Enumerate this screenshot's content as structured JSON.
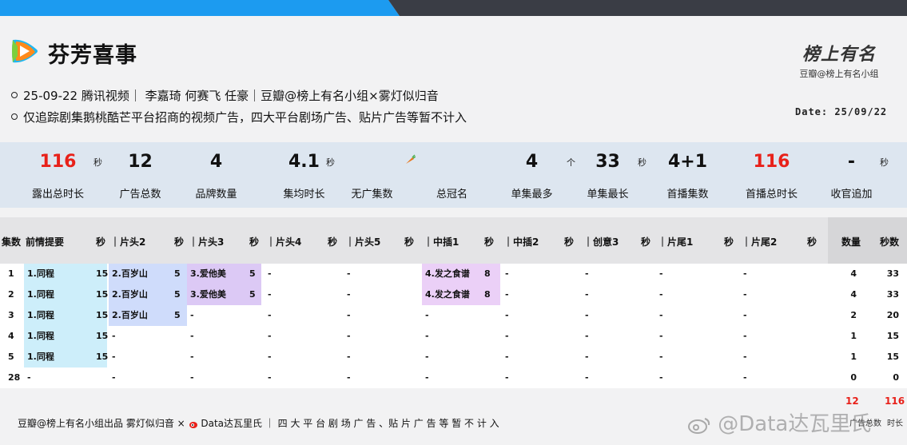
{
  "show": {
    "title": "芬芳喜事",
    "info_line_1": "25-09-22 腾讯视频｜ 李嘉琦 何赛飞 任豪｜豆瓣@榜上有名小组×雾灯似归音",
    "info_line_2": "仅追踪剧集鹅桃酷芒平台招商的视频广告，四大平台剧场广告、贴片广告等暂不计入",
    "date": "Date: 25/09/22"
  },
  "brand": {
    "script": "榜上有名",
    "sub": "豆瓣@榜上有名小组"
  },
  "stats": [
    {
      "value": "116",
      "unit": "秒",
      "label": "露出总时长",
      "red": true
    },
    {
      "value": "12",
      "unit": "",
      "label": "广告总数",
      "red": false
    },
    {
      "value": "4",
      "unit": "",
      "label": "品牌数量",
      "red": false
    },
    {
      "value": "4.1",
      "unit": "秒",
      "label": "集均时长",
      "red": false
    },
    {
      "value": "",
      "unit": "",
      "label": "无广集数",
      "red": false,
      "icon": "carrot-icon"
    },
    {
      "value": "",
      "unit": "",
      "label": "总冠名",
      "red": false
    },
    {
      "value": "4",
      "unit": "个",
      "label": "单集最多",
      "red": false
    },
    {
      "value": "33",
      "unit": "秒",
      "label": "单集最长",
      "red": false
    },
    {
      "value": "4+1",
      "unit": "",
      "label": "首播集数",
      "red": false
    },
    {
      "value": "116",
      "unit": "",
      "label": "首播总时长",
      "red": true
    },
    {
      "value": "-",
      "unit": "秒",
      "label": "收官追加",
      "red": false
    }
  ],
  "table": {
    "headers": {
      "episode": "集数",
      "cols": [
        "前情提要",
        "｜片头2",
        "｜片头3",
        "｜片头4",
        "｜片头5",
        "｜中插1",
        "｜中插2",
        "｜创意3",
        "｜片尾1",
        "｜片尾2"
      ],
      "sec": "秒",
      "count": "数量",
      "seconds": "秒数"
    },
    "rows": [
      {
        "ep": "1",
        "cells": [
          [
            "1.同程",
            "15"
          ],
          [
            "2.百岁山",
            "5"
          ],
          [
            "3.爱他美",
            "5"
          ],
          [
            "-",
            ""
          ],
          [
            "-",
            ""
          ],
          [
            "4.发之食谱",
            "8"
          ],
          [
            "-",
            ""
          ],
          [
            "-",
            ""
          ],
          [
            "-",
            ""
          ],
          [
            "-",
            ""
          ]
        ],
        "count": "4",
        "secs": "33"
      },
      {
        "ep": "2",
        "cells": [
          [
            "1.同程",
            "15"
          ],
          [
            "2.百岁山",
            "5"
          ],
          [
            "3.爱他美",
            "5"
          ],
          [
            "-",
            ""
          ],
          [
            "-",
            ""
          ],
          [
            "4.发之食谱",
            "8"
          ],
          [
            "-",
            ""
          ],
          [
            "-",
            ""
          ],
          [
            "-",
            ""
          ],
          [
            "-",
            ""
          ]
        ],
        "count": "4",
        "secs": "33"
      },
      {
        "ep": "3",
        "cells": [
          [
            "1.同程",
            "15"
          ],
          [
            "2.百岁山",
            "5"
          ],
          [
            "-",
            ""
          ],
          [
            "-",
            ""
          ],
          [
            "-",
            ""
          ],
          [
            "-",
            ""
          ],
          [
            "-",
            ""
          ],
          [
            "-",
            ""
          ],
          [
            "-",
            ""
          ],
          [
            "-",
            ""
          ]
        ],
        "count": "2",
        "secs": "20"
      },
      {
        "ep": "4",
        "cells": [
          [
            "1.同程",
            "15"
          ],
          [
            "-",
            ""
          ],
          [
            "-",
            ""
          ],
          [
            "-",
            ""
          ],
          [
            "-",
            ""
          ],
          [
            "-",
            ""
          ],
          [
            "-",
            ""
          ],
          [
            "-",
            ""
          ],
          [
            "-",
            ""
          ],
          [
            "-",
            ""
          ]
        ],
        "count": "1",
        "secs": "15"
      },
      {
        "ep": "5",
        "cells": [
          [
            "1.同程",
            "15"
          ],
          [
            "-",
            ""
          ],
          [
            "-",
            ""
          ],
          [
            "-",
            ""
          ],
          [
            "-",
            ""
          ],
          [
            "-",
            ""
          ],
          [
            "-",
            ""
          ],
          [
            "-",
            ""
          ],
          [
            "-",
            ""
          ],
          [
            "-",
            ""
          ]
        ],
        "count": "1",
        "secs": "15"
      },
      {
        "ep": "28",
        "cells": [
          [
            "-",
            ""
          ],
          [
            "-",
            ""
          ],
          [
            "-",
            ""
          ],
          [
            "-",
            ""
          ],
          [
            "-",
            ""
          ],
          [
            "-",
            ""
          ],
          [
            "-",
            ""
          ],
          [
            "-",
            ""
          ],
          [
            "-",
            ""
          ],
          [
            "-",
            ""
          ]
        ],
        "count": "0",
        "secs": "0"
      }
    ],
    "totals": {
      "count": "12",
      "secs": "116",
      "count_label": "广告总数",
      "secs_label": "时长"
    }
  },
  "footer": {
    "credit": "豆瓣@榜上有名小组出品  雾灯似归音 ×",
    "credit_2": "Data达瓦里氏 ｜ 四 大 平 台 剧 场 广 告 、贴 片 广 告 等 暂 不 计 入"
  },
  "watermark": "@Data达瓦里氏",
  "colors": {
    "accent_blue": "#1c9bf0",
    "red": "#e8211a",
    "stats_bg": "#dde6f0",
    "cyan": "#cdeefa",
    "blue": "#cfdcfb",
    "purple": "#dcc9f5",
    "pink": "#ebd0f7"
  }
}
